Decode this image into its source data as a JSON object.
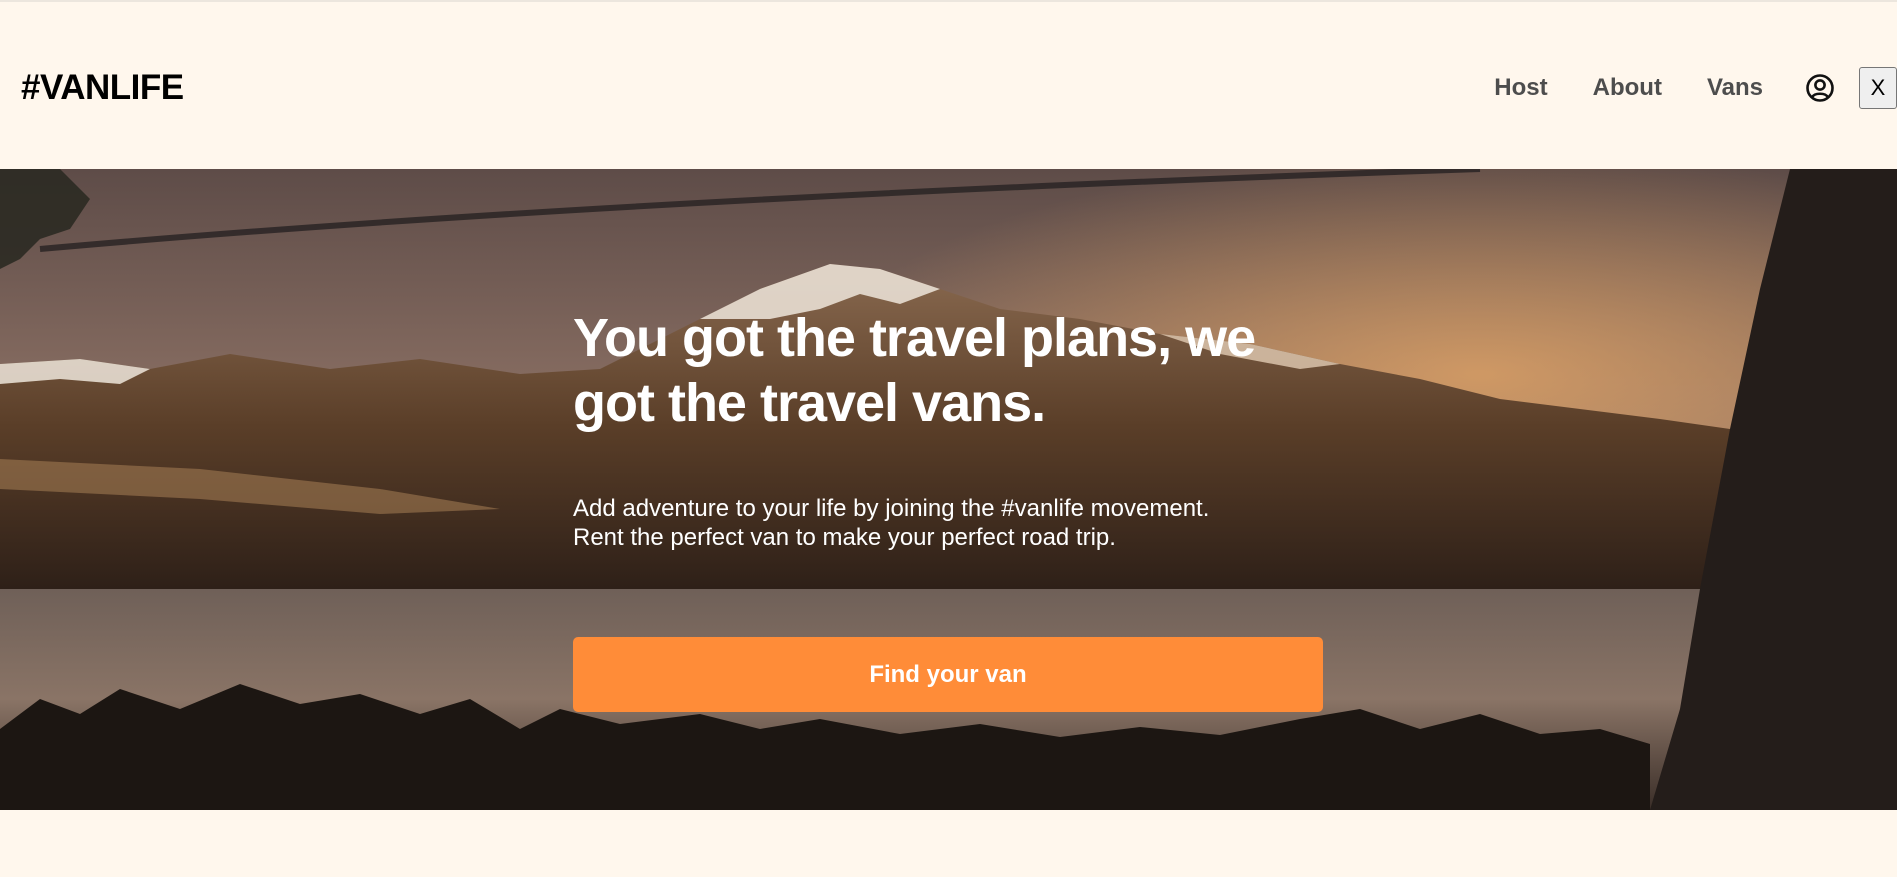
{
  "header": {
    "logo": "#VANLIFE",
    "nav": {
      "host": "Host",
      "about": "About",
      "vans": "Vans"
    },
    "user_icon": "user-circle-icon",
    "close_label": "X"
  },
  "hero": {
    "title": "You got the travel plans, we got the travel vans.",
    "subtitle_line1": "Add adventure to your life by joining the #vanlife movement.",
    "subtitle_line2": "Rent the perfect van to make your perfect road trip.",
    "cta_label": "Find your van"
  },
  "colors": {
    "page_bg": "#FFF7ED",
    "accent": "#FF8C38",
    "nav_text": "#4D4D4D",
    "hero_text": "#FFFFFF"
  }
}
